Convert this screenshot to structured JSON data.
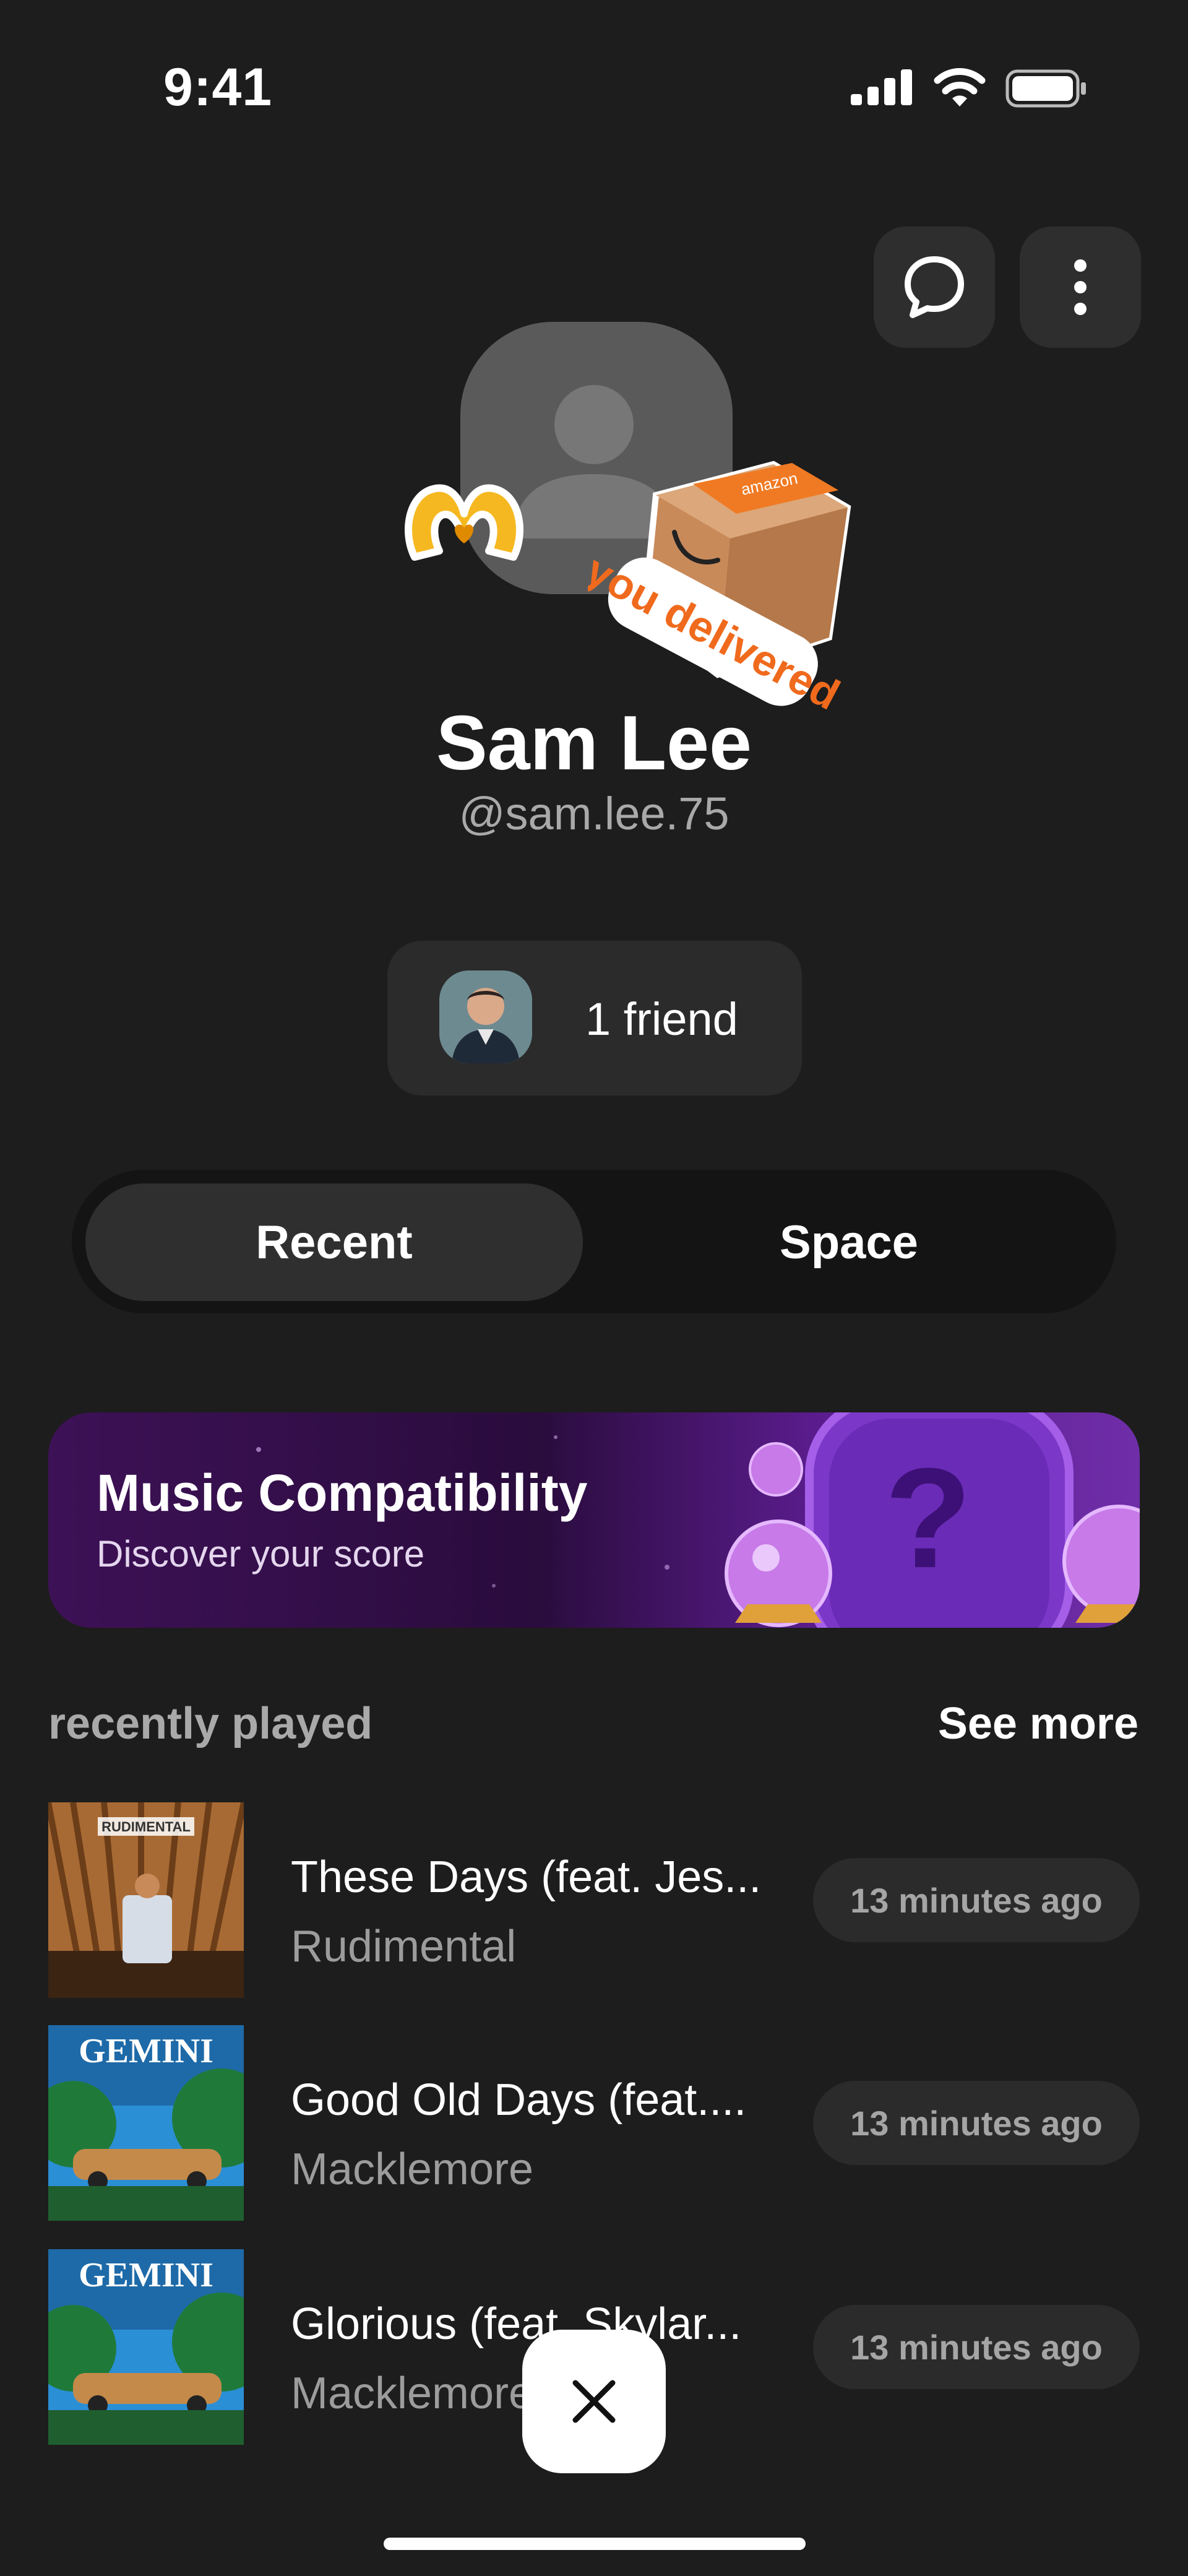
{
  "status_bar": {
    "time": "9:41",
    "signal_icon": "cellular-signal-icon",
    "wifi_icon": "wifi-icon",
    "battery_icon": "battery-icon"
  },
  "header_actions": {
    "chat_icon": "chat-bubble-icon",
    "more_icon": "more-vertical-icon"
  },
  "profile": {
    "name": "Sam Lee",
    "handle": "@sam.lee.75",
    "sticker_box_text": "you delivered",
    "sticker_box_tape": "amazon"
  },
  "friends": {
    "label": "1 friend"
  },
  "tabs": [
    {
      "label": "Recent",
      "selected": true
    },
    {
      "label": "Space",
      "selected": false
    }
  ],
  "banner": {
    "title": "Music Compatibility",
    "subtitle": "Discover your score"
  },
  "recently_played": {
    "title": "recently played",
    "see_more": "See more",
    "tracks": [
      {
        "title": "These Days (feat. Jes...",
        "artist": "Rudimental",
        "time": "13 minutes ago",
        "cover_text": "RUDIMENTAL"
      },
      {
        "title": "Good Old Days (feat....",
        "artist": "Macklemore",
        "time": "13 minutes ago",
        "cover_text": "GEMINI"
      },
      {
        "title": "Glorious (feat. Skylar...",
        "artist": "Macklemore",
        "time": "13 minutes ago",
        "cover_text": "GEMINI"
      }
    ]
  },
  "close_icon": "close-icon",
  "colors": {
    "background": "#1d1d1d",
    "surface": "#2b2b2b",
    "banner_purple": "#5a1c8c",
    "muted_text": "#a9a9a9"
  }
}
